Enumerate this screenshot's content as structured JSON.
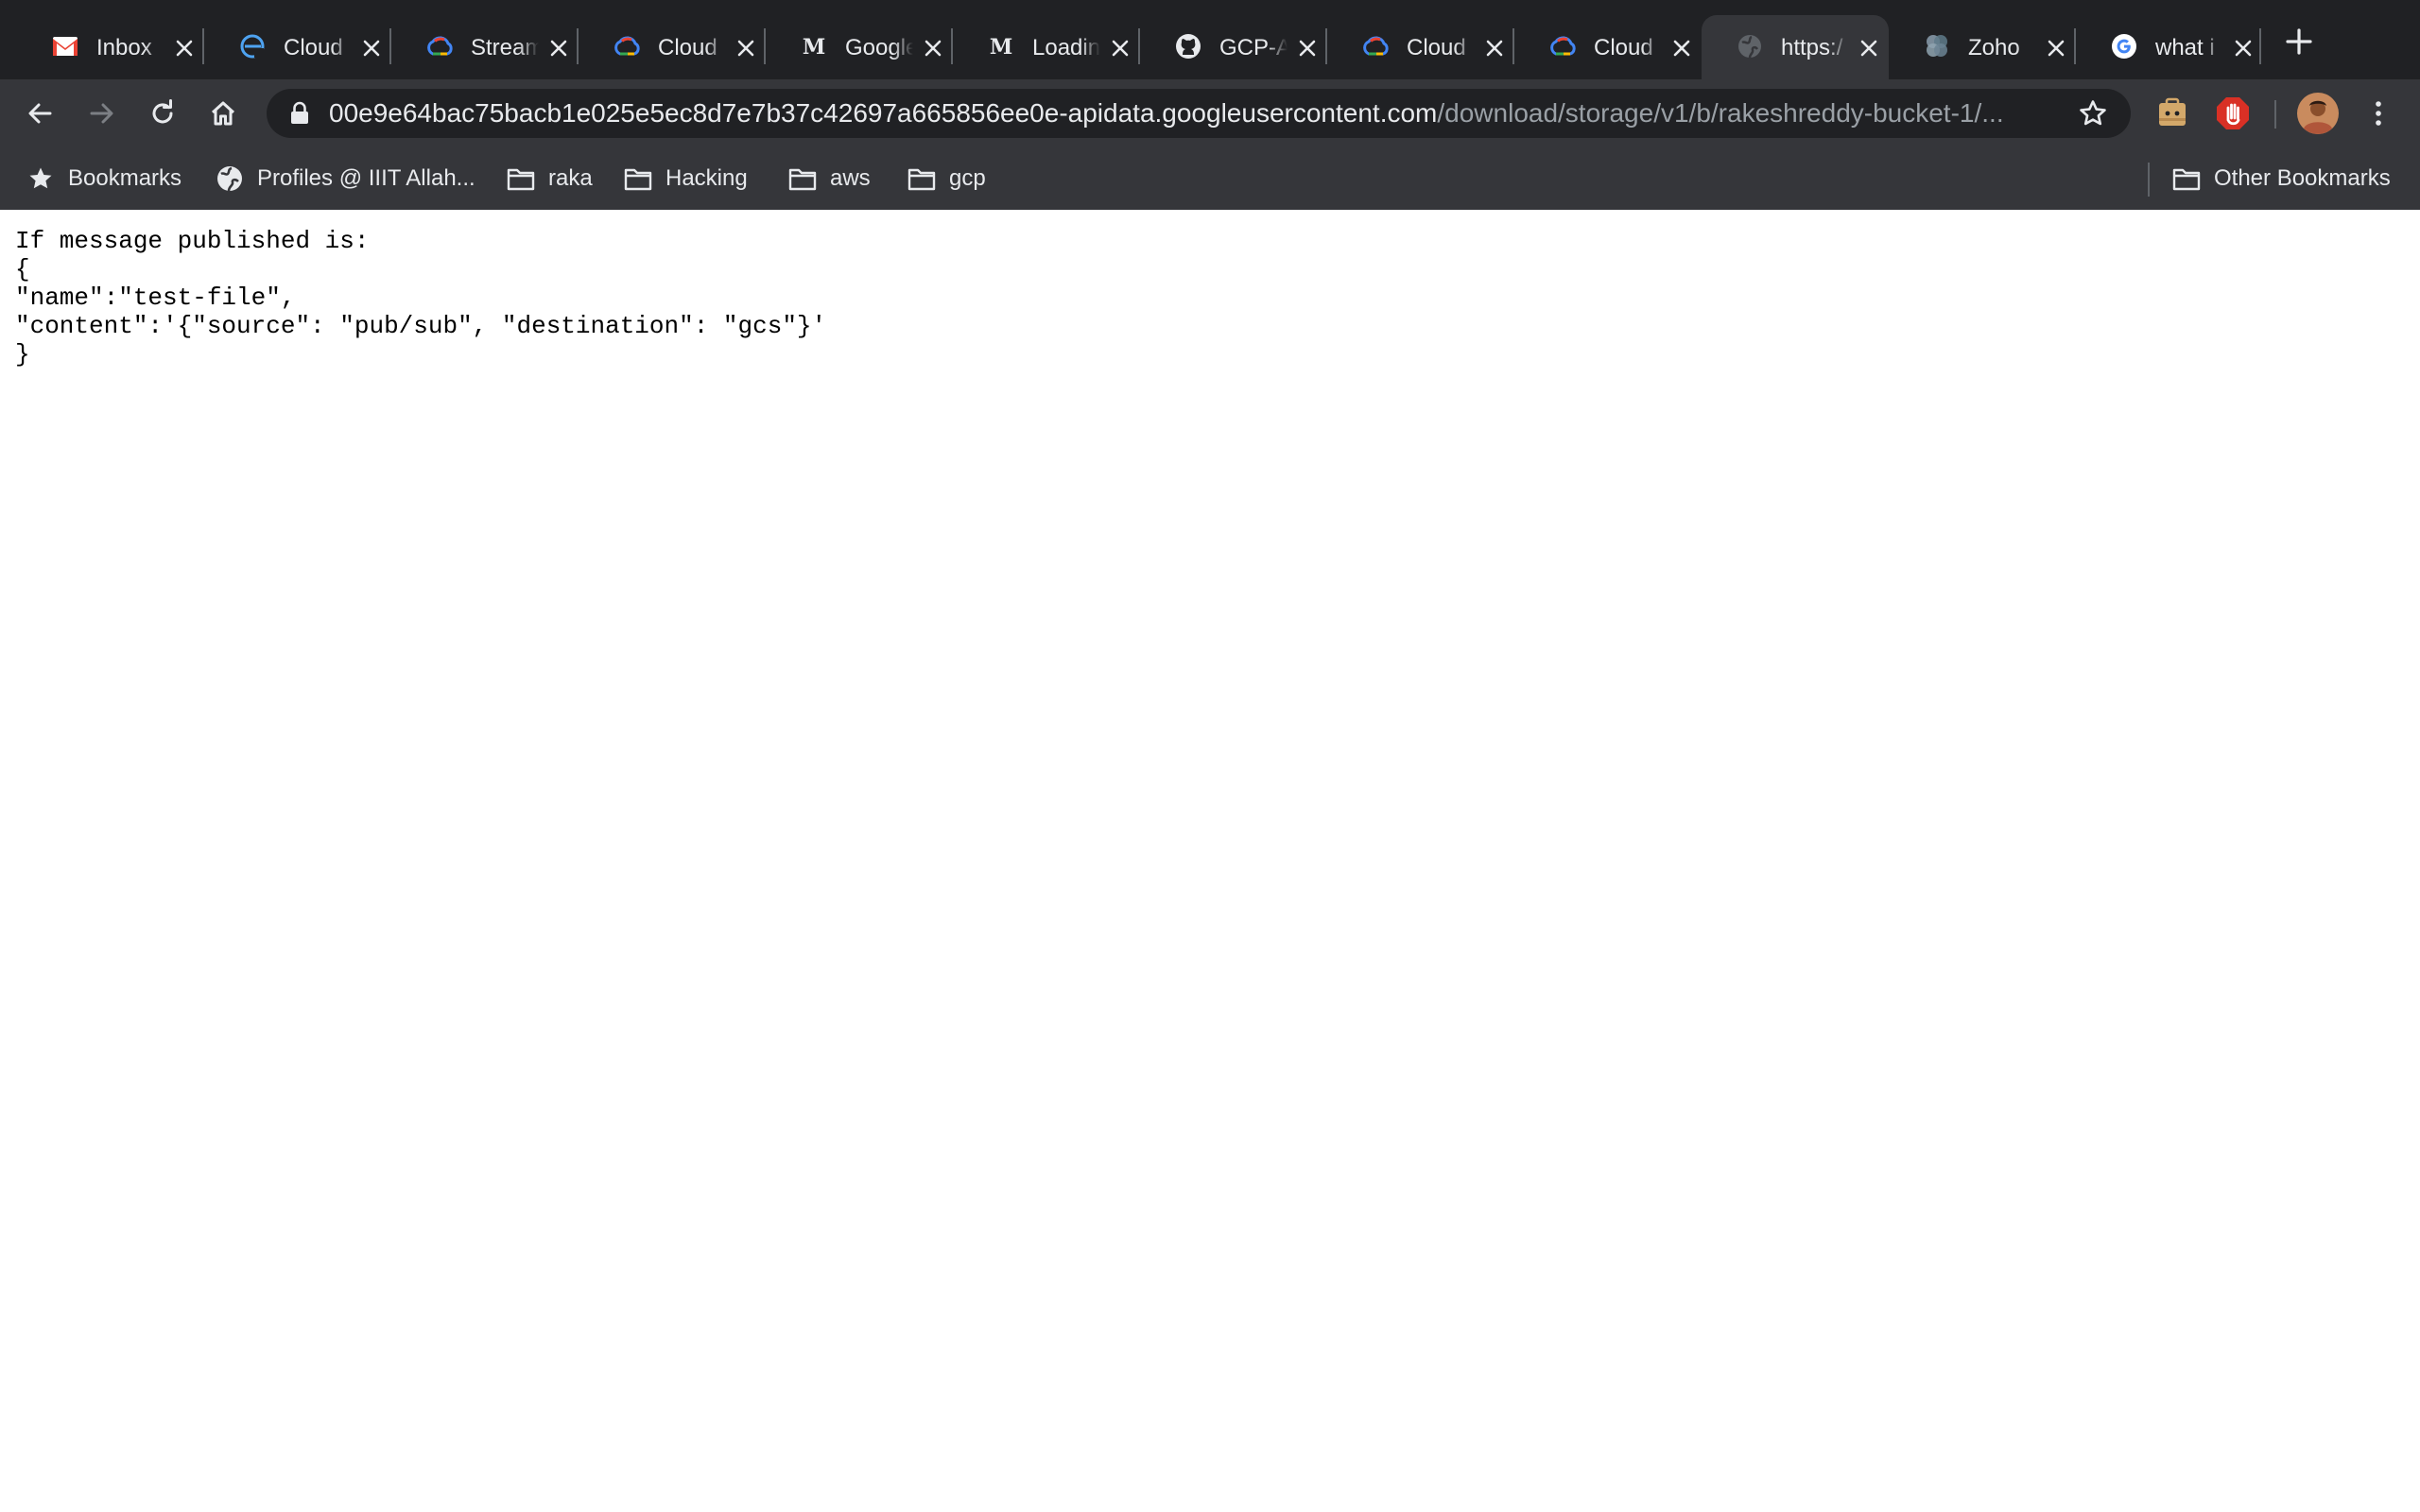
{
  "browser": {
    "tabs": [
      {
        "title": "Inbox",
        "icon": "gmail-icon"
      },
      {
        "title": "Cloud",
        "icon": "edge-icon"
      },
      {
        "title": "Stream",
        "icon": "google-cloud-icon"
      },
      {
        "title": "Cloud",
        "icon": "google-cloud-icon"
      },
      {
        "title": "Google",
        "icon": "medium-icon"
      },
      {
        "title": "Loading",
        "icon": "medium-icon"
      },
      {
        "title": "GCP-A",
        "icon": "github-icon"
      },
      {
        "title": "Cloud",
        "icon": "google-cloud-icon"
      },
      {
        "title": "Cloud",
        "icon": "google-cloud-icon"
      },
      {
        "title": "https:/",
        "icon": "globe-icon",
        "active": true
      },
      {
        "title": "Zoho",
        "icon": "zoho-icon"
      },
      {
        "title": "what i",
        "icon": "google-icon"
      }
    ],
    "url_host": "00e9e64bac75bacb1e025e5ec8d7e7b37c42697a665856ee0e-apidata.googleusercontent.com",
    "url_path": "/download/storage/v1/b/rakeshreddy-bucket-1/...",
    "bookmarks": [
      {
        "label": "Bookmarks",
        "icon": "star-icon"
      },
      {
        "label": "Profiles @ IIIT Allah...",
        "icon": "globe-icon"
      },
      {
        "label": "raka",
        "icon": "folder-icon"
      },
      {
        "label": "Hacking",
        "icon": "folder-icon"
      },
      {
        "label": "aws",
        "icon": "folder-icon"
      },
      {
        "label": "gcp",
        "icon": "folder-icon"
      }
    ],
    "other_bookmarks": "Other Bookmarks"
  },
  "document": {
    "lines": [
      "If message published is:",
      "{",
      "\"name\":\"test-file\",",
      "\"content\":'{\"source\": \"pub/sub\", \"destination\": \"gcs\"}'",
      "}"
    ]
  },
  "colors": {
    "chrome_bg": "#202124",
    "toolbar_bg": "#35363a",
    "text_light": "#e8eaed",
    "text_dim": "#9aa0a6",
    "page_bg": "#ffffff"
  }
}
